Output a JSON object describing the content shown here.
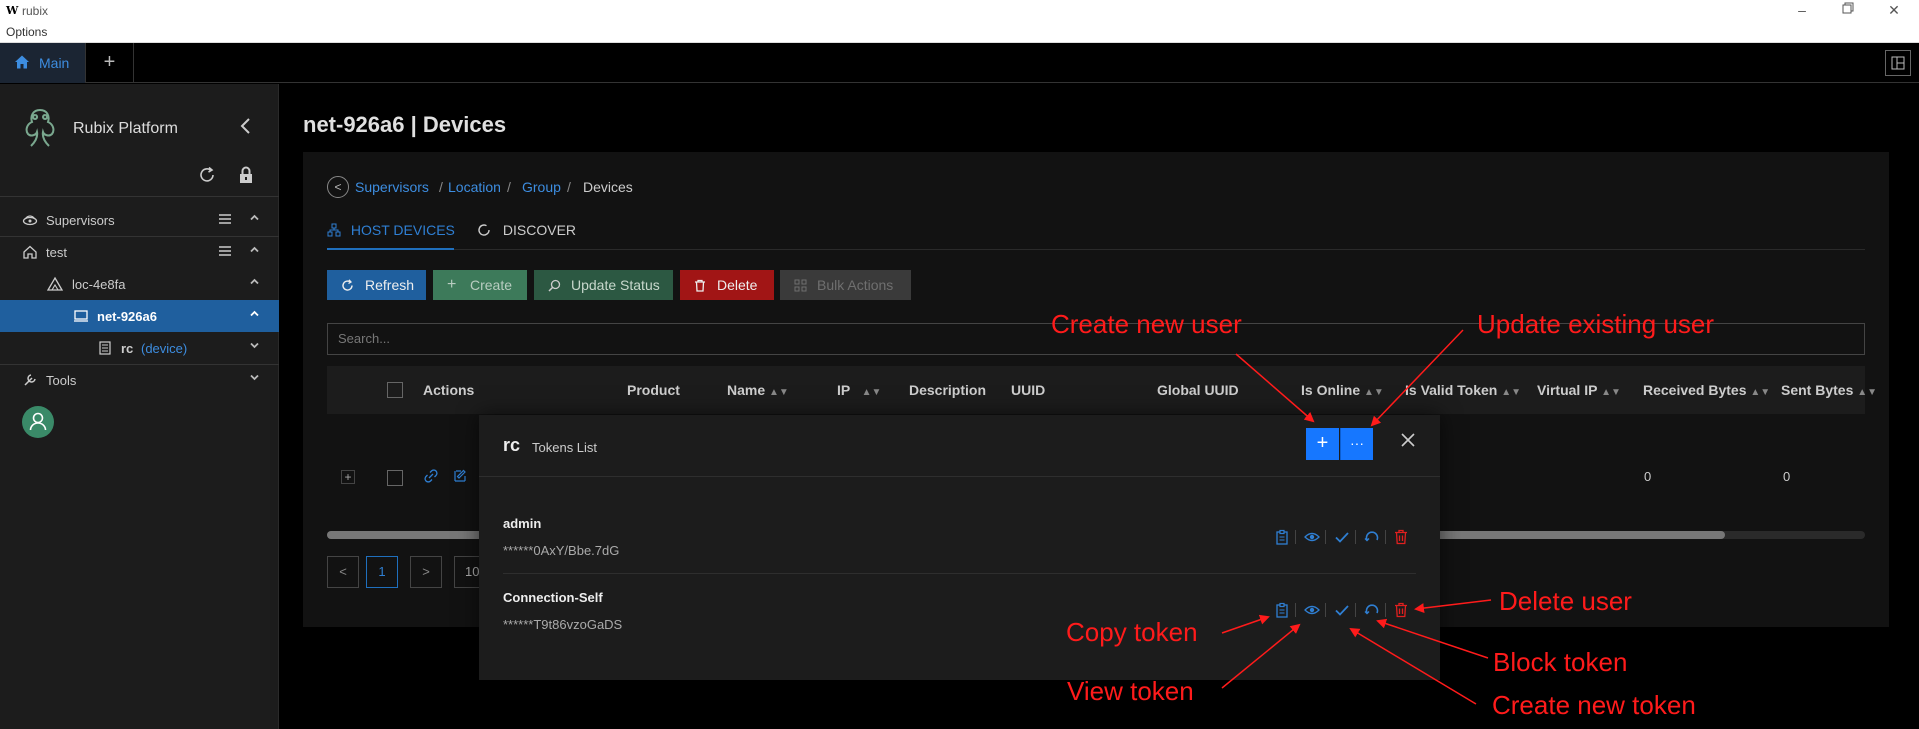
{
  "window": {
    "logo": "W",
    "title": "rubix",
    "menu": "Options"
  },
  "apptabs": {
    "main": "Main"
  },
  "sidebar": {
    "brand": "Rubix Platform",
    "items": [
      {
        "label": "Supervisors"
      },
      {
        "label": "test"
      },
      {
        "label": "loc-4e8fa"
      },
      {
        "label": "net-926a6"
      },
      {
        "label": "rc",
        "suffix": "(device)"
      },
      {
        "label": "Tools"
      }
    ]
  },
  "page": {
    "title": "net-926a6 | Devices"
  },
  "breadcrumb": {
    "items": [
      "Supervisors",
      "Location",
      "Group"
    ],
    "current": "Devices",
    "sep": "/"
  },
  "subtabs": {
    "host_devices": "HOST DEVICES",
    "discover": "DISCOVER"
  },
  "toolbar": {
    "refresh": "Refresh",
    "create": "Create",
    "update_status": "Update Status",
    "delete": "Delete",
    "bulk_actions": "Bulk Actions"
  },
  "search": {
    "placeholder": "Search..."
  },
  "table": {
    "columns": [
      "Actions",
      "Product",
      "Name",
      "IP",
      "Description",
      "UUID",
      "Global UUID",
      "Is Online",
      "Is Valid Token",
      "Virtual IP",
      "Received Bytes",
      "Sent Bytes"
    ],
    "rows": [
      {
        "received_bytes": "0",
        "sent_bytes": "0"
      }
    ]
  },
  "pagination": {
    "current": "1",
    "page_size": "10"
  },
  "modal": {
    "title": "rc",
    "subtitle": "Tokens List",
    "tokens": [
      {
        "name": "admin",
        "value": "******0AxY/Bbe.7dG"
      },
      {
        "name": "Connection-Self",
        "value": "******T9t86vzoGaDS"
      }
    ]
  },
  "annotations": {
    "create_new_user": "Create new user",
    "update_existing_user": "Update existing user",
    "delete_user": "Delete user",
    "copy_token": "Copy token",
    "block_token": "Block token",
    "view_token": "View token",
    "create_new_token": "Create new token"
  },
  "colors": {
    "accent": "#1677ff",
    "active_nav": "#1f5f9e",
    "create_btn": "#3d7a5a",
    "delete_btn": "#a11515",
    "annotation": "#ff1b1b"
  }
}
